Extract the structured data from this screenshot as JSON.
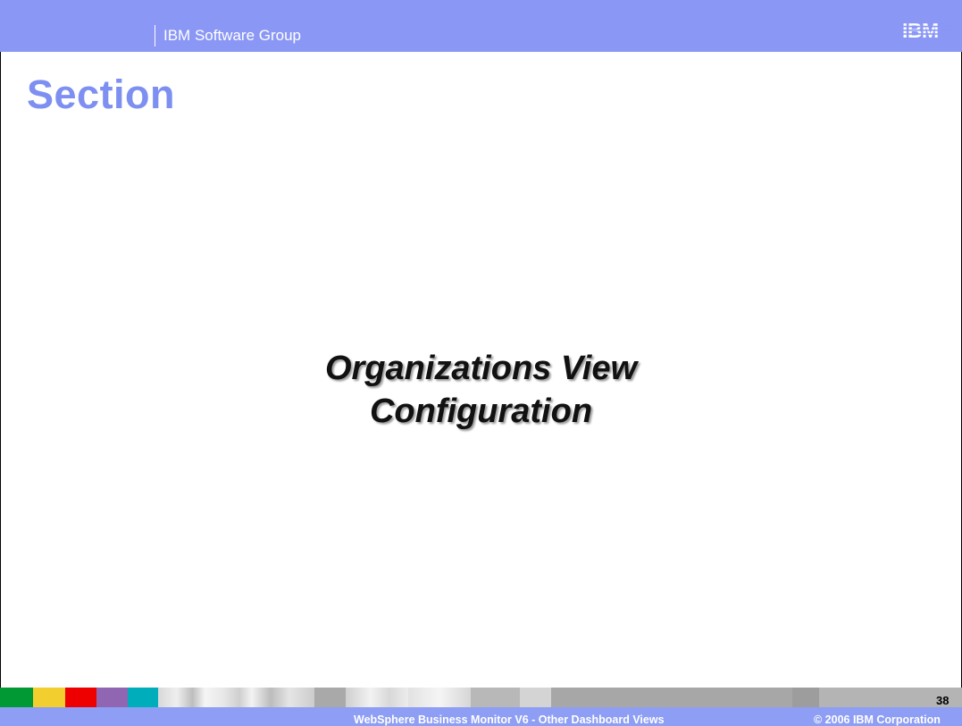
{
  "header": {
    "group": "IBM Software Group",
    "logo": "IBM"
  },
  "section": {
    "label": "Section"
  },
  "main": {
    "title_line1": "Organizations View",
    "title_line2": "Configuration"
  },
  "footer": {
    "page_number": "38",
    "presentation_title": "WebSphere Business Monitor V6 - Other Dashboard Views",
    "copyright": "© 2006 IBM Corporation"
  },
  "colors": {
    "header_background": "#8a97f5",
    "section_text": "#7e8ff2",
    "footer_background": "#8d9ef4",
    "footer_green": "#009933",
    "footer_yellow": "#f2cf2e",
    "footer_red": "#ee0000",
    "footer_purple": "#9066b2",
    "footer_teal": "#00aebb"
  }
}
